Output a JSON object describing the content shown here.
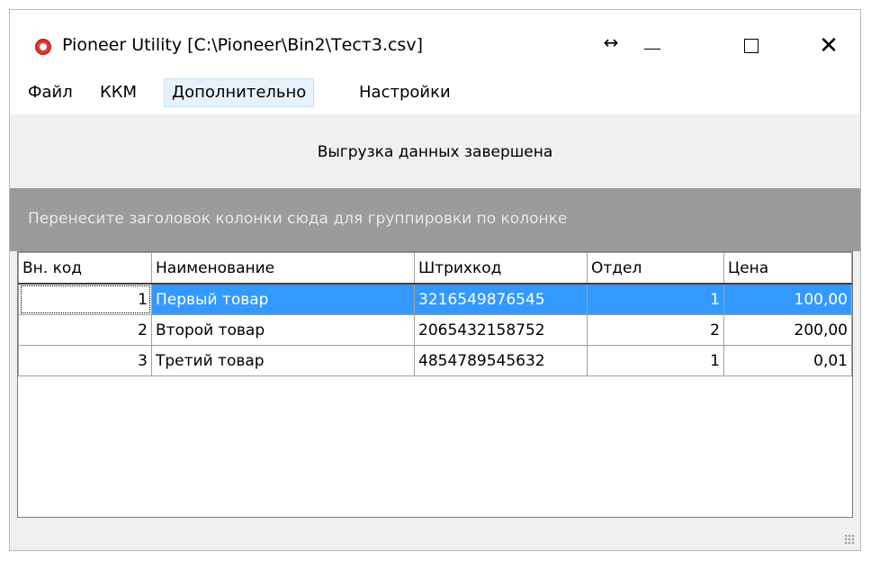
{
  "window": {
    "title": "Pioneer Utility [C:\\Pioneer\\Bin2\\Тест3.csv]",
    "resize_glyph": "↔",
    "close_glyph": "✕"
  },
  "menu": {
    "items": [
      "Файл",
      "ККМ",
      "Дополнительно",
      "Настройки"
    ],
    "active": "Дополнительно"
  },
  "status": {
    "message": "Выгрузка данных завершена"
  },
  "group_panel": {
    "hint": "Перенесите заголовок колонки сюда для группировки по колонке"
  },
  "grid": {
    "columns": [
      "Вн. код",
      "Наименование",
      "Штрихкод",
      "Отдел",
      "Цена"
    ],
    "rows": [
      [
        "1",
        "Первый товар",
        "3216549876545",
        "1",
        "100,00"
      ],
      [
        "2",
        "Второй товар",
        "2065432158752",
        "2",
        "200,00"
      ],
      [
        "3",
        "Третий товар",
        "4854789545632",
        "1",
        "0,01"
      ]
    ],
    "selected_row": 0
  },
  "colors": {
    "selection": "#3399ff",
    "group_panel": "#9b9b9b",
    "menu_active": "#e5f1fb"
  }
}
